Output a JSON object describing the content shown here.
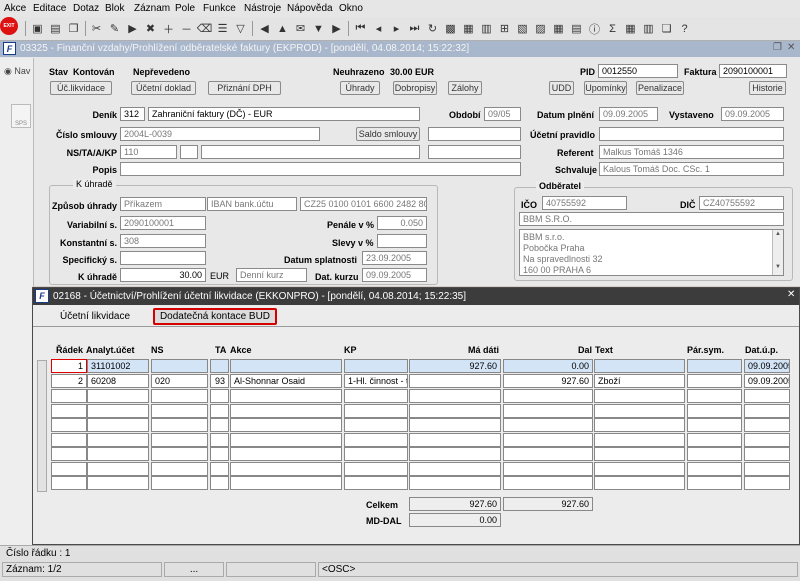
{
  "menu": [
    "Akce",
    "Editace",
    "Dotaz",
    "Blok",
    "Záznam",
    "Pole",
    "Funkce",
    "Nástroje",
    "Nápověda",
    "Okno"
  ],
  "toolbar": {
    "exit_label": "EXIT"
  },
  "main_window": {
    "title": "03325 - Finanční vzdahy/Prohlížení odběratelské faktury (EKPROD) - [pondělí, 04.08.2014; 15:22:32]",
    "nav_label": "Nav",
    "sps_label": "SPS",
    "header": {
      "stav_label": "Stav",
      "stav_value": "Kontován",
      "neprevedeno": "Nepřevedeno",
      "neuhrazeno_label": "Neuhrazeno",
      "neuhrazeno_value": "30.00 EUR",
      "pid_label": "PID",
      "pid_value": "0012550",
      "faktura_label": "Faktura",
      "faktura_value": "2090100001"
    },
    "buttons": [
      "Úč.likvidace",
      "Účetní doklad",
      "Přiznání DPH",
      "Úhrady",
      "Dobropisy",
      "Zálohy",
      "UDD",
      "Upomínky",
      "Penalizace",
      "Historie"
    ],
    "fields": {
      "denik_label": "Deník",
      "denik_code": "312",
      "denik_value": "Zahraniční faktury (DČ) - EUR",
      "obdobi_label": "Období",
      "obdobi_value": "09/05",
      "datum_plneni_label": "Datum plnění",
      "datum_plneni_value": "09.09.2005",
      "vystaveno_label": "Vystaveno",
      "vystaveno_value": "09.09.2005",
      "cislo_smlouvy_label": "Číslo smlouvy",
      "cislo_smlouvy_value": "2004L-0039",
      "saldo_smlouvy": "Saldo smlouvy",
      "ucetni_pravidlo_label": "Účetní pravidlo",
      "ns_label": "NS/TA/A/KP",
      "ns_value": "110",
      "referent_label": "Referent",
      "referent_value": "Malkus Tomáš 1346",
      "popis_label": "Popis",
      "schvaluje_label": "Schvaluje",
      "schvaluje_value": "Kalous Tomáš Doc. CSc. 1"
    },
    "uhrada": {
      "group_label": "K úhradě",
      "zpusob_label": "Způsob úhrady",
      "zpusob_value": "Příkazem",
      "iban_label": "IBAN bank.účtu",
      "iban_value": "CZ25 0100 0101 6600 2482 809",
      "variabilni_label": "Variabilní s.",
      "variabilni_value": "2090100001",
      "penale_label": "Penále v %",
      "penale_value": "0.050",
      "konstantni_label": "Konstantní s.",
      "konstantni_value": "308",
      "slevy_label": "Slevy v %",
      "slevy_value": "",
      "specificky_label": "Specifický s.",
      "datum_splatnosti_label": "Datum splatnosti",
      "datum_splatnosti_value": "23.09.2005",
      "k_uhrade_label": "K úhradě",
      "k_uhrade_value": "30.00",
      "mena": "EUR",
      "kurz_type": "Denní kurz",
      "dat_kurzu_label": "Dat. kurzu",
      "dat_kurzu_value": "09.09.2005"
    },
    "odberatel": {
      "group_label": "Odběratel",
      "ico_label": "IČO",
      "ico_value": "40755592",
      "dic_label": "DIČ",
      "dic_value": "CZ40755592",
      "name": "BBM S.R.O.",
      "address": [
        "BBM s.r.o.",
        "Pobočka Praha",
        "Na spravedlnosti 32",
        "160 00 PRAHA 6"
      ]
    }
  },
  "sub_window": {
    "title": "02168 - Účetnictví/Prohlížení účetní likvidace (EKKONPRO) - [pondělí, 04.08.2014; 15:22:35]",
    "tabs": [
      "Účetní likvidace",
      "Dodatečná kontace BUD"
    ],
    "columns": {
      "radek": "Řádek",
      "analyt": "Analyt.účet",
      "ns": "NS",
      "ta": "TA",
      "akce": "Akce",
      "kp": "KP",
      "ma_dati": "Má dáti",
      "dal": "Dal",
      "text": "Text",
      "par_sym": "Pár.sym.",
      "dat_up": "Dat.ú.p."
    },
    "rows": [
      {
        "radek": "1",
        "analyt": "31101002",
        "ns": "",
        "ta": "",
        "akce": "",
        "kp": "",
        "ma_dati": "927.60",
        "dal": "0.00",
        "text": "",
        "par_sym": "",
        "dat_up": "09.09.2005"
      },
      {
        "radek": "2",
        "analyt": "60208",
        "ns": "020",
        "ta": "93",
        "akce": "Al-Shonnar Osaid",
        "kp": "1-Hl. činnost - te",
        "ma_dati": "",
        "dal": "927.60",
        "text": "Zboží",
        "par_sym": "",
        "dat_up": "09.09.2005"
      }
    ],
    "celkem_label": "Celkem",
    "celkem_ma_dati": "927.60",
    "celkem_dal": "927.60",
    "md_dal_label": "MD-DAL",
    "md_dal_value": "0.00"
  },
  "status": {
    "row_number": "Číslo řádku : 1",
    "record": "Záznam: 1/2",
    "dots": "...",
    "osc": "<OSC>"
  }
}
